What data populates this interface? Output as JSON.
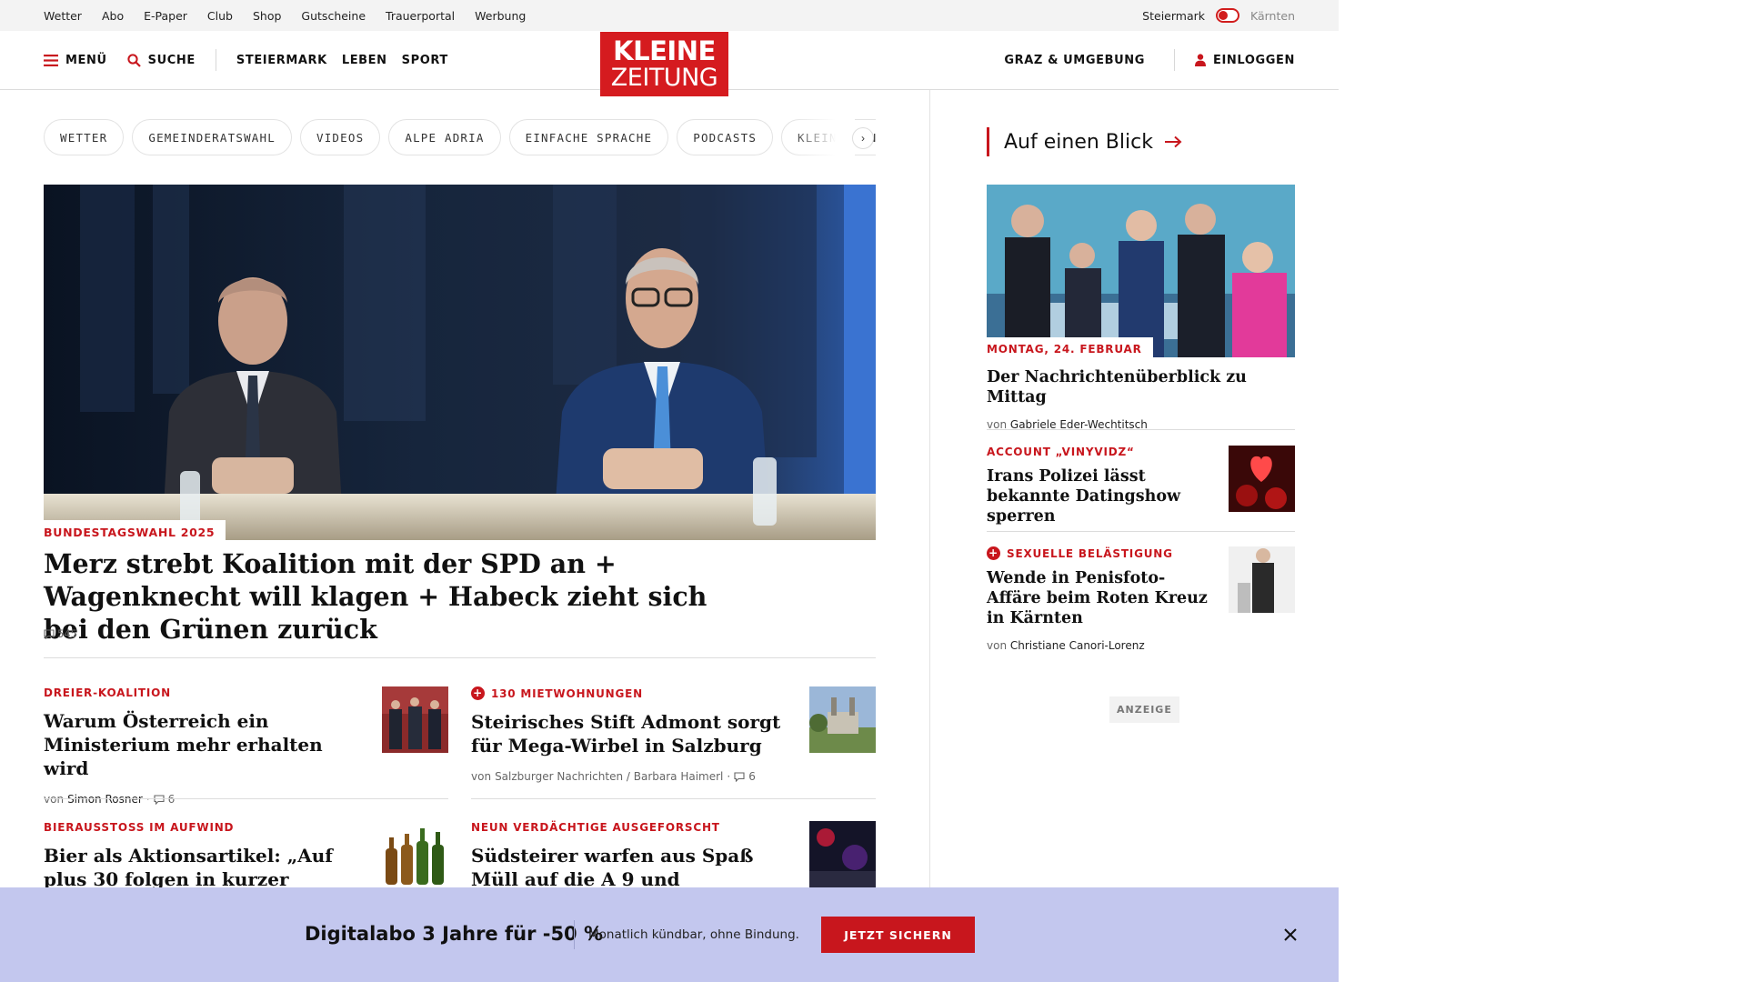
{
  "utility_bar": {
    "links": [
      "Wetter",
      "Abo",
      "E-Paper",
      "Club",
      "Shop",
      "Gutscheine",
      "Trauerportal",
      "Werbung"
    ],
    "region_active": "Steiermark",
    "region_inactive": "Kärnten"
  },
  "header": {
    "menu_label": "MENÜ",
    "search_label": "SUCHE",
    "nav": [
      "STEIERMARK",
      "LEBEN",
      "SPORT"
    ],
    "logo_line1": "KLEINE",
    "logo_line2": "ZEITUNG",
    "local_label": "GRAZ & UMGEBUNG",
    "login_label": "EINLOGGEN",
    "brand_color": "#d51b1f"
  },
  "chips": [
    "WETTER",
    "GEMEINDERATSWAHL",
    "VIDEOS",
    "ALPE ADRIA",
    "EINFACHE SPRACHE",
    "PODCASTS",
    "KLEINE KINDERZEITUNG"
  ],
  "hero": {
    "kicker": "BUNDESTAGSWAHL 2025",
    "title": "Merz strebt Koalition mit der SPD an + Wagenknecht will klagen + Habeck zieht sich bei den Grünen zurück",
    "comments": "545"
  },
  "articles": [
    {
      "kicker": "DREIER-KOALITION",
      "plus": false,
      "title": "Warum Österreich ein Ministerium mehr erhalten wird",
      "by": "von",
      "author": "Simon Rosner",
      "comments": "6"
    },
    {
      "kicker": "130 MIETWOHNUNGEN",
      "plus": true,
      "title": "Steirisches Stift Admont sorgt für Mega-Wirbel in Salzburg",
      "by": "von",
      "author": "Salzburger Nachrichten / Barbara Haimerl",
      "comments": "6"
    },
    {
      "kicker": "BIERAUSSTOSS IM AUFWIND",
      "plus": false,
      "title": "Bier als Aktionsartikel: „Auf plus 30 folgen in kurzer"
    },
    {
      "kicker": "NEUN VERDÄCHTIGE AUSGEFORSCHT",
      "plus": false,
      "title": "Südsteirer warfen aus Spaß Müll auf die A 9 und"
    }
  ],
  "sidebar": {
    "heading": "Auf einen Blick",
    "lead": {
      "kicker": "MONTAG, 24. FEBRUAR",
      "title": "Der Nachrichtenüberblick zu Mittag",
      "by": "von",
      "author": "Gabriele Eder-Wechtitsch"
    },
    "items": [
      {
        "kicker": "ACCOUNT „VINYVIDZ“",
        "plus": false,
        "title": "Irans Polizei lässt bekannte Datingshow sperren"
      },
      {
        "kicker": "SEXUELLE BELÄSTIGUNG",
        "plus": true,
        "title": "Wende in Penisfoto-Affäre beim Roten Kreuz in Kärnten",
        "by": "von",
        "author": "Christiane Canori-Lorenz"
      }
    ],
    "ad_label": "ANZEIGE"
  },
  "promo": {
    "title": "Digitalabo 3 Jahre für -50 %",
    "subtitle": "Monatlich kündbar, ohne Bindung.",
    "button": "JETZT SICHERN",
    "background": "#c3c7ee",
    "button_color": "#c8161d"
  }
}
